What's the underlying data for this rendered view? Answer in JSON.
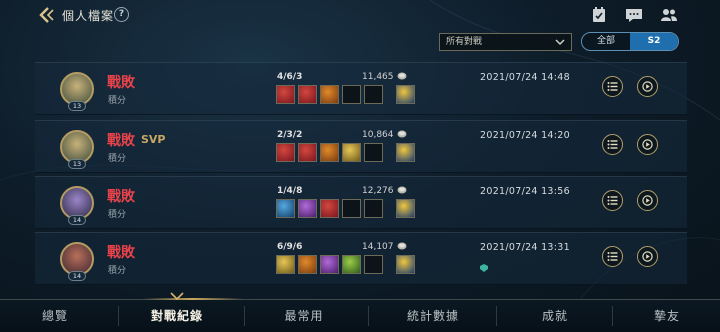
{
  "header": {
    "title": "個人檔案",
    "help_label": "?"
  },
  "filter": {
    "selected": "所有對戰"
  },
  "mode_toggle": {
    "options": [
      "全部",
      "S2"
    ],
    "selected": "S2"
  },
  "matches": [
    {
      "result": "戰敗",
      "svp": "",
      "queue": "積分",
      "level": "13",
      "kda": "4/6/3",
      "gold": "11,465",
      "date": "2021/07/24 14:48",
      "items": [
        "red-item",
        "red-item",
        "orange-item",
        "empty",
        "empty",
        "ward-trinket"
      ],
      "has_tag": false
    },
    {
      "result": "戰敗",
      "svp": "SVP",
      "queue": "積分",
      "level": "13",
      "kda": "2/3/2",
      "gold": "10,864",
      "date": "2021/07/24 14:20",
      "items": [
        "red-item",
        "red-item",
        "orange-item",
        "gold-item",
        "empty",
        "ward-trinket"
      ],
      "has_tag": false
    },
    {
      "result": "戰敗",
      "svp": "",
      "queue": "積分",
      "level": "14",
      "kda": "1/4/8",
      "gold": "12,276",
      "date": "2021/07/24 13:56",
      "items": [
        "blue-item",
        "purple-item",
        "red-item",
        "empty",
        "empty",
        "ward-trinket"
      ],
      "has_tag": false
    },
    {
      "result": "戰敗",
      "svp": "",
      "queue": "積分",
      "level": "14",
      "kda": "6/9/6",
      "gold": "14,107",
      "date": "2021/07/24 13:31",
      "items": [
        "gold-item",
        "orange-item",
        "purple-item",
        "green-item",
        "empty",
        "ward-trinket"
      ],
      "has_tag": true
    }
  ],
  "bottom_nav": {
    "items": [
      "總覽",
      "對戰紀錄",
      "最常用",
      "統計數據",
      "成就",
      "摯友"
    ],
    "active": "對戰紀錄"
  },
  "colors": {
    "defeat": "#e8434a",
    "svp": "#c6a766",
    "gold_frame": "#b2a06c",
    "toggle_active": "#1f6fae"
  },
  "icons": [
    "back-arrow-icon",
    "help-icon",
    "calendar-check-icon",
    "chat-icon",
    "friends-icon",
    "chevron-down-icon",
    "gold-coin-icon",
    "details-list-icon",
    "replay-icon"
  ]
}
